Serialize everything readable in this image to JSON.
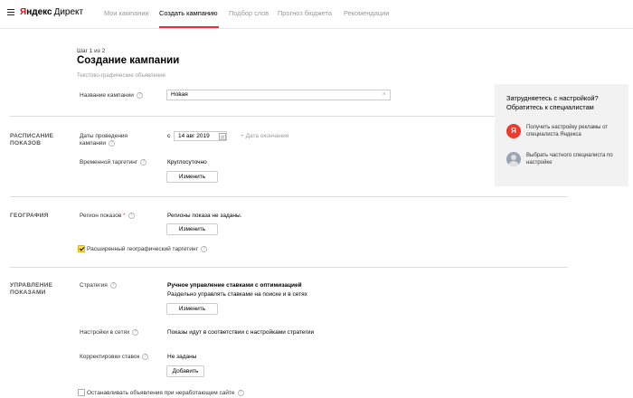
{
  "header": {
    "logo_ya": "Я",
    "logo_rest": "ндекс",
    "logo_direct": "Директ",
    "nav": [
      {
        "label": "Мои кампании"
      },
      {
        "label": "Создать кампанию"
      },
      {
        "label": "Подбор слов"
      },
      {
        "label": "Прогноз бюджета"
      },
      {
        "label": "Рекомендации"
      }
    ]
  },
  "page": {
    "step": "Шаг 1 из 2",
    "title": "Создание кампании",
    "subtitle": "Текстово-графические объявления"
  },
  "campaign_name": {
    "label": "Название кампании",
    "value": "Новая",
    "clear": "×"
  },
  "schedule": {
    "section_title_1": "РАСПИСАНИЕ",
    "section_title_2": "ПОКАЗОВ",
    "dates_label_1": "Даты проведения",
    "dates_label_2": "кампании",
    "from_prefix": "с",
    "start_date": "14 авг 2019",
    "end_date_link": "+ Дата окончания",
    "time_target_label": "Временной таргетинг",
    "time_target_value": "Круглосуточно",
    "change_button": "Изменить"
  },
  "geo": {
    "section_title": "ГЕОГРАФИЯ",
    "region_label": "Регион показов",
    "required_mark": "*",
    "region_value": "Регионы показа не заданы.",
    "change_button": "Изменить",
    "extended_label": "Расширенный географический таргетинг",
    "extended_checked": true
  },
  "management": {
    "section_title_1": "УПРАВЛЕНИЕ",
    "section_title_2": "ПОКАЗАМИ",
    "strategy_label": "Стратегия",
    "strategy_title": "Ручное управление ставками с оптимизацией",
    "strategy_desc": "Раздельно управлять ставками на поиске и в сетях",
    "change_button": "Изменить",
    "network_label": "Настройки в сетях",
    "network_value": "Показы идут в соответствии с настройками стратегии",
    "bid_adj_label": "Корректировки ставок",
    "bid_adj_value": "Не заданы",
    "add_button": "Добавить",
    "stop_label": "Останавливать объявления при неработающем сайте",
    "stop_checked": false
  },
  "help": {
    "title": "Затрудняетесь с настройкой? Обратитесь к специалистам",
    "item1": "Получить настройку рекламы от специалиста Яндекса",
    "item1_icon": "Я",
    "item2": "Выбрать частного специалиста по настройке"
  },
  "icons": {
    "question": "?"
  },
  "colors": {
    "accent": "#e0332c",
    "logo_red": "#ff0000",
    "checkbox_yellow": "#ffdb4d",
    "help_bg": "#f2f2f2"
  }
}
